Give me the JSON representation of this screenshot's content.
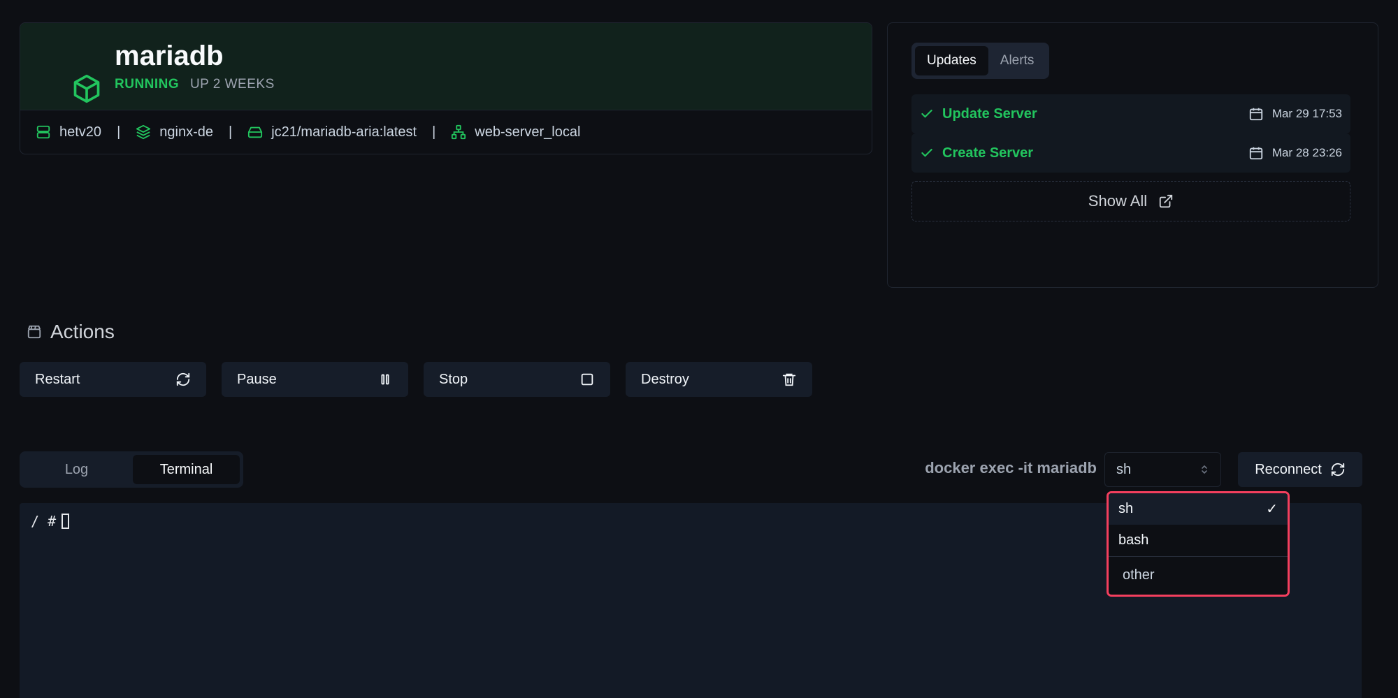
{
  "container": {
    "name": "mariadb",
    "state": "RUNNING",
    "uptime": "UP 2 WEEKS",
    "server": "hetv20",
    "stack": "nginx-de",
    "image": "jc21/mariadb-aria:latest",
    "network": "web-server_local",
    "separator": "|"
  },
  "updates_panel": {
    "tabs": [
      "Updates",
      "Alerts"
    ],
    "active_tab": "Updates",
    "items": [
      {
        "name": "Update Server",
        "time": "Mar 29 17:53"
      },
      {
        "name": "Create Server",
        "time": "Mar 28 23:26"
      }
    ],
    "show_all": "Show All"
  },
  "actions": {
    "title": "Actions",
    "buttons": [
      {
        "label": "Restart",
        "icon": "refresh-icon"
      },
      {
        "label": "Pause",
        "icon": "pause-icon"
      },
      {
        "label": "Stop",
        "icon": "stop-icon"
      },
      {
        "label": "Destroy",
        "icon": "trash-icon"
      }
    ]
  },
  "console": {
    "tabs": [
      "Log",
      "Terminal"
    ],
    "active_tab": "Terminal",
    "exec_prefix": "docker exec -it mariadb",
    "shell_value": "sh",
    "reconnect_label": "Reconnect",
    "prompt": "/ #",
    "shell_options": [
      {
        "label": "sh",
        "selected": true
      },
      {
        "label": "bash",
        "selected": false
      },
      {
        "label": "other",
        "selected": false
      }
    ]
  },
  "colors": {
    "accent_green": "#22c55e",
    "highlight_border": "#f43f5e",
    "background": "#0d0f14"
  }
}
